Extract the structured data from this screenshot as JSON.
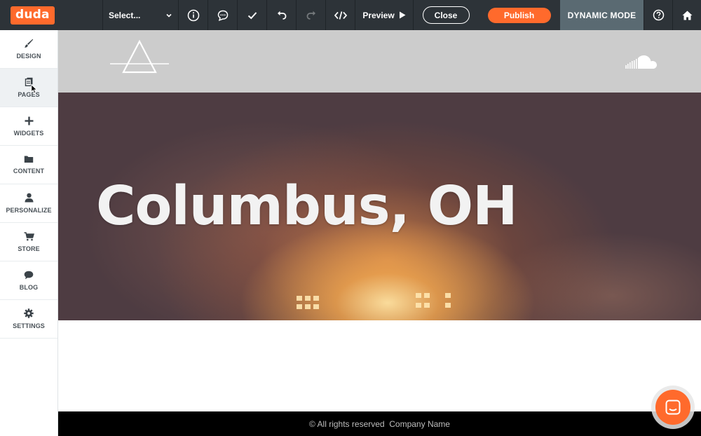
{
  "app": {
    "logo_text": "duda",
    "brand_color": "#ff6a2c"
  },
  "toolbar": {
    "select_label": "Select...",
    "preview_label": "Preview",
    "close_label": "Close",
    "publish_label": "Publish",
    "dynamic_mode_label": "DYNAMIC MODE",
    "icons": [
      "info-icon",
      "comment-icon",
      "check-icon",
      "undo-icon",
      "redo-icon",
      "code-icon",
      "help-icon",
      "home-icon"
    ]
  },
  "sidebar": {
    "items": [
      {
        "label": "DESIGN",
        "icon": "brush-icon"
      },
      {
        "label": "PAGES",
        "icon": "pages-icon"
      },
      {
        "label": "WIDGETS",
        "icon": "plus-icon"
      },
      {
        "label": "CONTENT",
        "icon": "folder-icon"
      },
      {
        "label": "PERSONALIZE",
        "icon": "person-icon"
      },
      {
        "label": "STORE",
        "icon": "cart-icon"
      },
      {
        "label": "BLOG",
        "icon": "chat-bubble-icon"
      },
      {
        "label": "SETTINGS",
        "icon": "gear-icon"
      }
    ],
    "active_item": "PAGES"
  },
  "site": {
    "hero_title": "Columbus, OH",
    "footer_text": "© All rights reserved  Company Name",
    "header_bg": "#cccccc"
  }
}
